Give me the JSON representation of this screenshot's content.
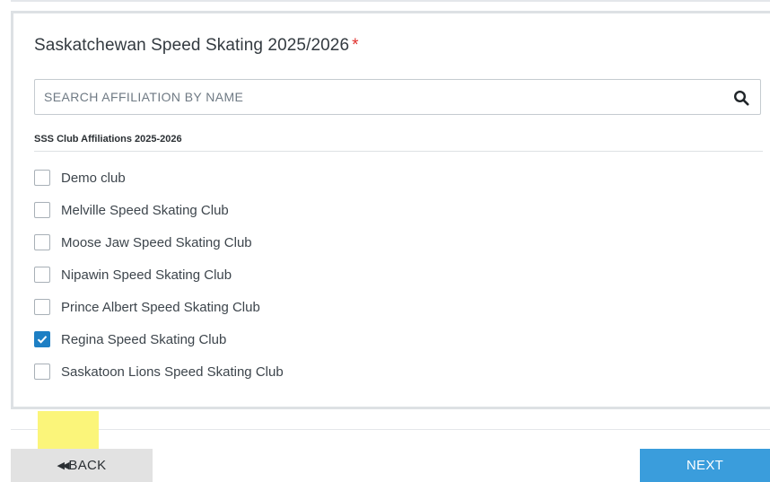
{
  "form": {
    "title": "Saskatchewan Speed Skating 2025/2026",
    "required_marker": "*",
    "search": {
      "placeholder": "SEARCH AFFILIATION BY NAME",
      "value": "",
      "icon": "search-icon"
    },
    "section_label": "SSS Club Affiliations 2025-2026",
    "clubs": [
      {
        "label": "Demo club",
        "checked": false
      },
      {
        "label": "Melville Speed Skating Club",
        "checked": false
      },
      {
        "label": "Moose Jaw Speed Skating Club",
        "checked": false
      },
      {
        "label": "Nipawin Speed Skating Club",
        "checked": false
      },
      {
        "label": "Prince Albert Speed Skating Club",
        "checked": false
      },
      {
        "label": "Regina Speed Skating Club",
        "checked": true
      },
      {
        "label": "Saskatoon Lions Speed Skating Club",
        "checked": false
      }
    ]
  },
  "footer": {
    "back_label": "BACK",
    "back_icon": "double-chevron-left-icon",
    "next_label": "NEXT"
  },
  "colors": {
    "accent": "#1d7fc4",
    "next_button": "#3a9ddc",
    "back_button": "#e2e2e2",
    "required": "#e0312e",
    "highlight": "#fbf57a"
  }
}
